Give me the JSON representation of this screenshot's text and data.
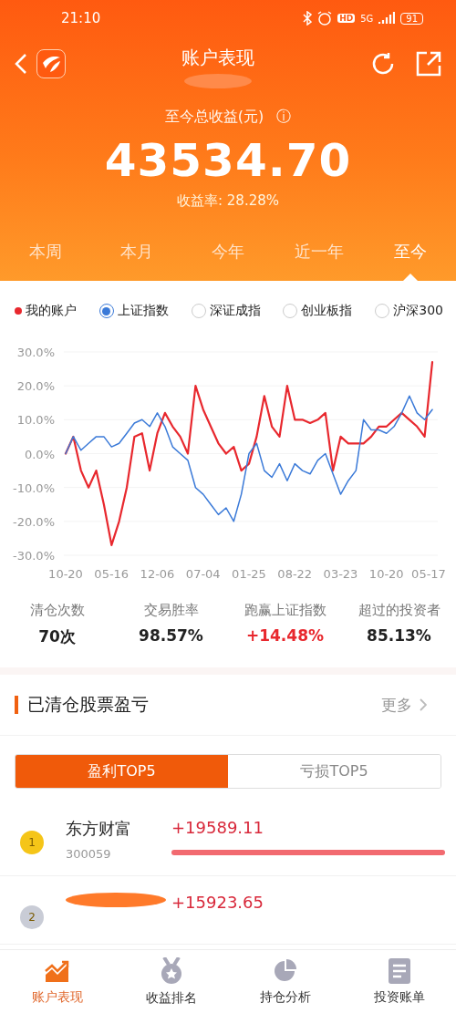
{
  "status_bar": {
    "time": "21:10",
    "hd": "HD",
    "network": "5G",
    "battery": "91"
  },
  "header": {
    "title": "账户表现",
    "subtitle_redacted": true
  },
  "summary": {
    "label": "至今总收益(元)",
    "info": "ⓘ",
    "amount": "43534.70",
    "rate": "收益率: 28.28%"
  },
  "period_tabs": [
    {
      "label": "本周",
      "selected": false
    },
    {
      "label": "本月",
      "selected": false
    },
    {
      "label": "今年",
      "selected": false
    },
    {
      "label": "近一年",
      "selected": false
    },
    {
      "label": "至今",
      "selected": true
    }
  ],
  "legend": [
    {
      "kind": "dot",
      "label": "我的账户",
      "color": "#e8282e"
    },
    {
      "kind": "radio",
      "label": "上证指数",
      "selected": true
    },
    {
      "kind": "radio",
      "label": "深证成指",
      "selected": false
    },
    {
      "kind": "radio",
      "label": "创业板指",
      "selected": false
    },
    {
      "kind": "radio",
      "label": "沪深300",
      "selected": false
    }
  ],
  "chart": {
    "chart_data": {
      "type": "line",
      "categories": [
        "10-20",
        null,
        null,
        null,
        null,
        null,
        "05-16",
        null,
        null,
        null,
        null,
        null,
        "12-06",
        null,
        null,
        null,
        null,
        null,
        "07-04",
        null,
        null,
        null,
        null,
        null,
        "01-25",
        null,
        null,
        null,
        null,
        null,
        "08-22",
        null,
        null,
        null,
        null,
        null,
        "03-23",
        null,
        null,
        null,
        null,
        null,
        "10-20",
        null,
        null,
        null,
        null,
        null,
        "05-17"
      ],
      "series": [
        {
          "color": "#e8282e",
          "values": [
            0,
            5,
            -5,
            -10,
            -5,
            -15,
            -27,
            -20,
            -10,
            5,
            6,
            -5,
            6,
            12,
            8,
            5,
            0,
            20,
            13,
            8,
            3,
            0,
            2,
            -5,
            -3,
            5,
            17,
            8,
            5,
            20,
            10,
            10,
            9,
            10,
            12,
            -5,
            5,
            3,
            3,
            3,
            5,
            8,
            8,
            10,
            12,
            10,
            8,
            5,
            27
          ]
        },
        {
          "color": "#3b7ad8",
          "values": [
            0,
            5,
            1,
            3,
            5,
            5,
            2,
            3,
            6,
            9,
            10,
            8,
            12,
            8,
            2,
            0,
            -2,
            -10,
            -12,
            -15,
            -18,
            -16,
            -20,
            -12,
            0,
            3,
            -5,
            -7,
            -3,
            -8,
            -3,
            -5,
            -6,
            -2,
            0,
            -6,
            -12,
            -8,
            -5,
            10,
            7,
            7,
            6,
            8,
            12,
            17,
            12,
            10,
            13
          ]
        }
      ],
      "grid": true,
      "ylim": [
        -30,
        30
      ],
      "yticks": [
        {
          "value": 30,
          "label": "30.0%"
        },
        {
          "value": 20,
          "label": "20.0%"
        },
        {
          "value": 10,
          "label": "10.0%"
        },
        {
          "value": 0,
          "label": "0.0%"
        },
        {
          "value": -10,
          "label": "-10.0%"
        },
        {
          "value": -20,
          "label": "-20.0%"
        },
        {
          "value": -30,
          "label": "-30.0%"
        }
      ]
    }
  },
  "stats": [
    {
      "label": "清仓次数",
      "value": "70次",
      "positive": false
    },
    {
      "label": "交易胜率",
      "value": "98.57%",
      "positive": false
    },
    {
      "label": "跑赢上证指数",
      "value": "+14.48%",
      "positive": true
    },
    {
      "label": "超过的投资者",
      "value": "85.13%",
      "positive": false
    }
  ],
  "section": {
    "title": "已清仓股票盈亏",
    "more": "更多"
  },
  "toggle": [
    {
      "label": "盈利TOP5",
      "selected": true
    },
    {
      "label": "亏损TOP5",
      "selected": false
    }
  ],
  "rows": [
    {
      "rank": "1",
      "color": "#f5c518",
      "redacted": false,
      "name": "东方财富",
      "code": "300059",
      "amount": "+19589.11",
      "level": 1
    },
    {
      "rank": "2",
      "color": "#c9ccd6",
      "redacted": true,
      "amount": "+15923.65"
    }
  ],
  "bottom_nav": [
    {
      "label": "账户表现",
      "kind": "trend",
      "selected": true
    },
    {
      "label": "收益排名",
      "kind": "medal",
      "selected": false
    },
    {
      "label": "持仓分析",
      "kind": "pie",
      "selected": false
    },
    {
      "label": "投资账单",
      "kind": "doc",
      "selected": false
    }
  ]
}
